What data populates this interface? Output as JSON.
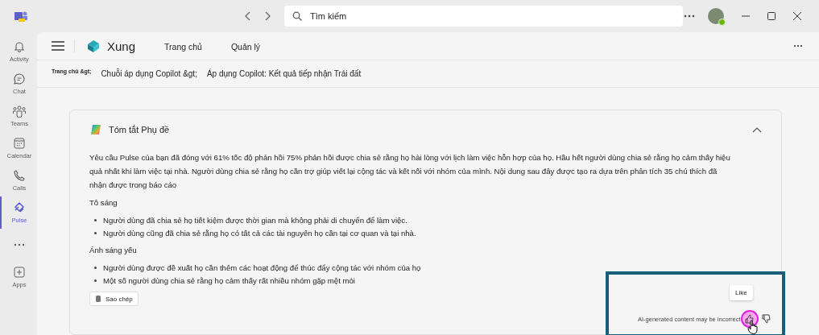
{
  "title_bar": {
    "search": {
      "placeholder": "Tìm kiếm"
    }
  },
  "rail": {
    "items": [
      {
        "kind": "activity",
        "label": "Activity",
        "selected": false
      },
      {
        "kind": "chat",
        "label": "Chat",
        "selected": false
      },
      {
        "kind": "teams",
        "label": "Teams",
        "selected": false
      },
      {
        "kind": "calendar",
        "label": "Calendar",
        "selected": false
      },
      {
        "kind": "calls",
        "label": "Calls",
        "selected": false
      },
      {
        "kind": "pulse",
        "label": "Pulse",
        "selected": true
      },
      {
        "kind": "more",
        "selected": false
      },
      {
        "kind": "apps",
        "label": "Apps",
        "selected": false
      }
    ]
  },
  "app_header": {
    "name": "Xung",
    "tabs": [
      {
        "label": "Trang chủ",
        "selected": false
      },
      {
        "label": "Quản lý",
        "selected": false
      }
    ]
  },
  "breadcrumb": [
    "Trang chủ &gt;",
    "Chuỗi áp dụng Copilot &gt;",
    "Áp dụng Copilot: Kết quả tiếp nhận Trái đất"
  ],
  "card": {
    "title": "Tóm tắt Phụ đề",
    "expanded": true,
    "summary": "Yêu cầu Pulse của bạn đã đóng với 61% tốc độ phản hồi 75% phản hồi được chia sẻ rằng họ hài lòng với lịch làm việc hỗn hợp của họ. Hầu hết người dùng chia sẻ rằng họ cảm thấy hiệu quả nhất khi làm việc tại nhà. Người dùng chia sẻ rằng họ cần trợ giúp viết lại cộng tác và kết nối với nhóm của mình. Nội dung sau đây được tạo ra dựa trên phân tích 35 chú thích đã nhận được trong báo cáo",
    "sections": [
      {
        "heading": "Tô sáng",
        "bullets": [
          "Người dùng đã chia sẻ họ tiết kiệm được thời gian mà không phải di chuyển để làm việc.",
          "Người dùng cũng đã chia sẻ rằng họ có tất cả các tài nguyên họ cần tại cơ quan và tại nhà."
        ]
      },
      {
        "heading": "Ánh sáng yếu",
        "bullets": [
          "Người dùng được đề xuất họ cần thêm các hoạt động để thúc đẩy cộng tác với nhóm của họ",
          "Một số người dùng chia sẻ rằng họ cảm thấy rất nhiều nhóm gặp mệt mỏi"
        ]
      }
    ],
    "copy_button": "Sao chép"
  },
  "feedback": {
    "disclaimer": "AI-generated content may be incorrect",
    "tooltip": "Like"
  }
}
